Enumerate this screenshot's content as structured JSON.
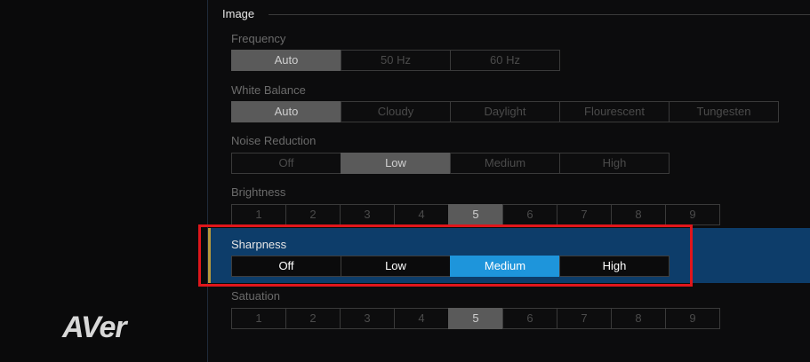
{
  "logo_text": "AVer",
  "section": {
    "title": "Image"
  },
  "frequency": {
    "label": "Frequency",
    "options": [
      "Auto",
      "50 Hz",
      "60 Hz"
    ],
    "selected": "Auto"
  },
  "white_balance": {
    "label": "White Balance",
    "options": [
      "Auto",
      "Cloudy",
      "Daylight",
      "Flourescent",
      "Tungesten"
    ],
    "selected": "Auto"
  },
  "noise_reduction": {
    "label": "Noise Reduction",
    "options": [
      "Off",
      "Low",
      "Medium",
      "High"
    ],
    "selected": "Low"
  },
  "brightness": {
    "label": "Brightness",
    "options": [
      "1",
      "2",
      "3",
      "4",
      "5",
      "6",
      "7",
      "8",
      "9"
    ],
    "selected": "5"
  },
  "sharpness": {
    "label": "Sharpness",
    "options": [
      "Off",
      "Low",
      "Medium",
      "High"
    ],
    "selected": "Medium"
  },
  "saturation": {
    "label": "Satuation",
    "options": [
      "1",
      "2",
      "3",
      "4",
      "5",
      "6",
      "7",
      "8",
      "9"
    ],
    "selected": "5"
  },
  "colors": {
    "accent": "#1e95db",
    "active_row": "#0d3d6a",
    "highlight": "#e0161b",
    "selected_gray": "#5a5a5a"
  }
}
